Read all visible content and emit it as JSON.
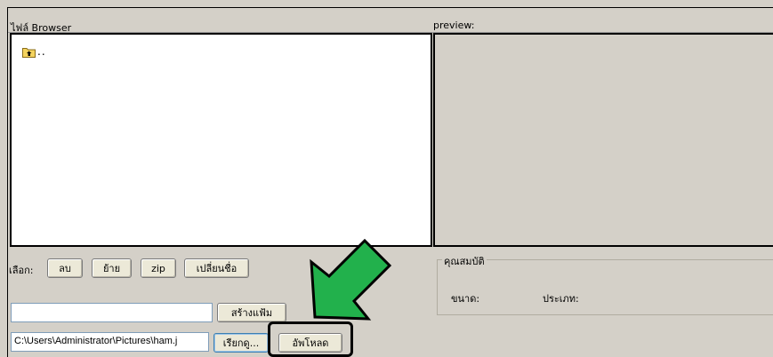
{
  "file_browser": {
    "title": "ไฟล์ Browser",
    "up_label": ".."
  },
  "preview": {
    "title": "preview:"
  },
  "actions": {
    "select_label": "เลือก:",
    "delete": "ลบ",
    "move": "ย้าย",
    "zip": "zip",
    "rename": "เปลี่ยนชื่อ"
  },
  "new_folder": {
    "value": "",
    "button": "สร้างแฟ้ม"
  },
  "upload": {
    "path": "C:\\Users\\Administrator\\Pictures\\ham.j",
    "browse": "เรียกดู...",
    "upload_button": "อัพโหลด"
  },
  "properties": {
    "title": "คุณสมบัติ",
    "size_label": "ขนาด:",
    "type_label": "ประเภท:"
  },
  "colors": {
    "arrow": "#22b14c",
    "background": "#d4d0c8"
  }
}
